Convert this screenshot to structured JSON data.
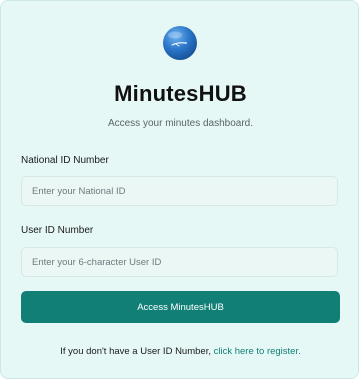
{
  "app": {
    "title": "MinutesHUB",
    "subtitle": "Access your minutes dashboard.",
    "logo_icon": "globe-icon"
  },
  "form": {
    "national_id": {
      "label": "National ID Number",
      "value": "",
      "placeholder": "Enter your National ID"
    },
    "user_id": {
      "label": "User ID Number",
      "value": "",
      "placeholder": "Enter your 6-character User ID"
    },
    "submit_label": "Access MinutesHUB"
  },
  "footer": {
    "text": "If you don't have a User ID Number,",
    "link_text": "click here to register."
  },
  "colors": {
    "card_background": "#e6f8f6",
    "accent": "#127f77",
    "link": "#127f77"
  }
}
